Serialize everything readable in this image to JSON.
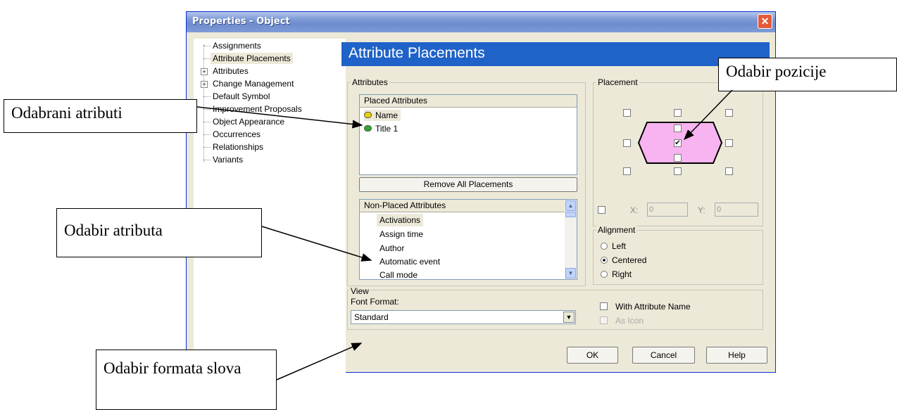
{
  "window": {
    "title": "Properties - Object",
    "close_icon": "close-icon"
  },
  "tree": {
    "items": [
      {
        "label": "Assignments",
        "expandable": false
      },
      {
        "label": "Attribute Placements",
        "expandable": false,
        "selected": true
      },
      {
        "label": "Attributes",
        "expandable": true
      },
      {
        "label": "Change Management",
        "expandable": true
      },
      {
        "label": "Default Symbol",
        "expandable": false
      },
      {
        "label": "Improvement Proposals",
        "expandable": false
      },
      {
        "label": "Object Appearance",
        "expandable": false
      },
      {
        "label": "Occurrences",
        "expandable": false
      },
      {
        "label": "Relationships",
        "expandable": false
      },
      {
        "label": "Variants",
        "expandable": false
      }
    ]
  },
  "banner": {
    "title": "Attribute Placements"
  },
  "attributes": {
    "group_label": "Attributes",
    "placed_header": "Placed Attributes",
    "placed_items": [
      {
        "label": "Name",
        "icon": "attribute-yellow-icon"
      },
      {
        "label": "Title 1",
        "icon": "attribute-green-icon"
      }
    ],
    "remove_all_label": "Remove All Placements",
    "non_placed_header": "Non-Placed Attributes",
    "non_placed_items": [
      "Activations",
      "Assign time",
      "Author",
      "Automatic event",
      "Call mode"
    ]
  },
  "placement": {
    "group_label": "Placement",
    "x_label": "X:",
    "x_value": "0",
    "y_label": "Y:",
    "y_value": "0",
    "shape_color": "#f8b4f0"
  },
  "alignment": {
    "group_label": "Alignment",
    "options": [
      {
        "label": "Left",
        "selected": false
      },
      {
        "label": "Centered",
        "selected": true
      },
      {
        "label": "Right",
        "selected": false
      }
    ]
  },
  "view": {
    "group_label": "View",
    "font_format_label": "Font Format:",
    "font_format_value": "Standard",
    "with_attribute_name_label": "With Attribute Name",
    "as_icon_label": "As Icon"
  },
  "buttons": {
    "ok": "OK",
    "cancel": "Cancel",
    "help": "Help"
  },
  "callouts": {
    "selected_attributes": "Odabrani atributi",
    "position_selection": "Odabir pozicije",
    "attribute_selection": "Odabir atributa",
    "font_format_selection": "Odabir formata slova"
  }
}
